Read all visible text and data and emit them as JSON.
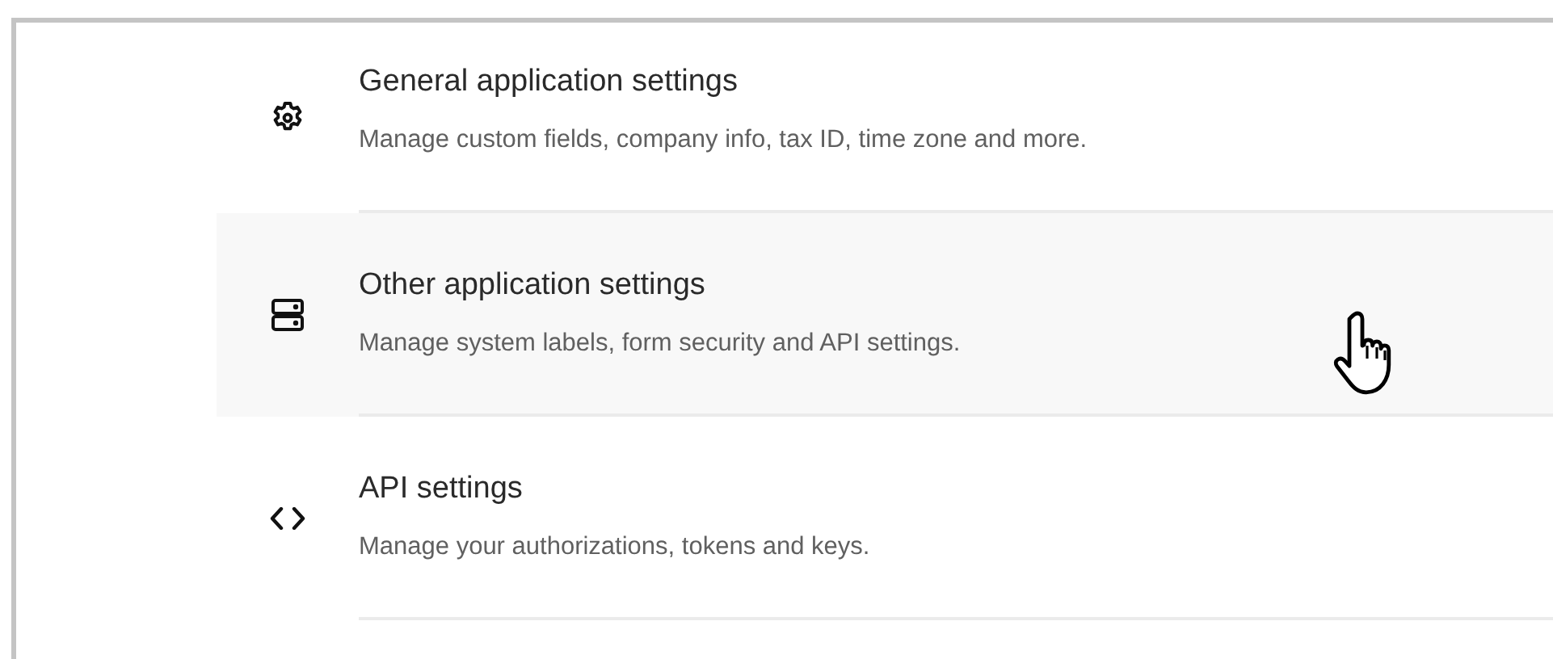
{
  "settings_items": [
    {
      "kind": "gear",
      "title": "General application settings",
      "description": "Manage custom fields, company info, tax ID, time zone and more.",
      "hovered": false
    },
    {
      "kind": "server",
      "title": "Other application settings",
      "description": "Manage system labels, form security and API settings.",
      "hovered": true
    },
    {
      "kind": "code",
      "title": "API settings",
      "description": "Manage your authorizations, tokens and keys.",
      "hovered": false
    }
  ]
}
